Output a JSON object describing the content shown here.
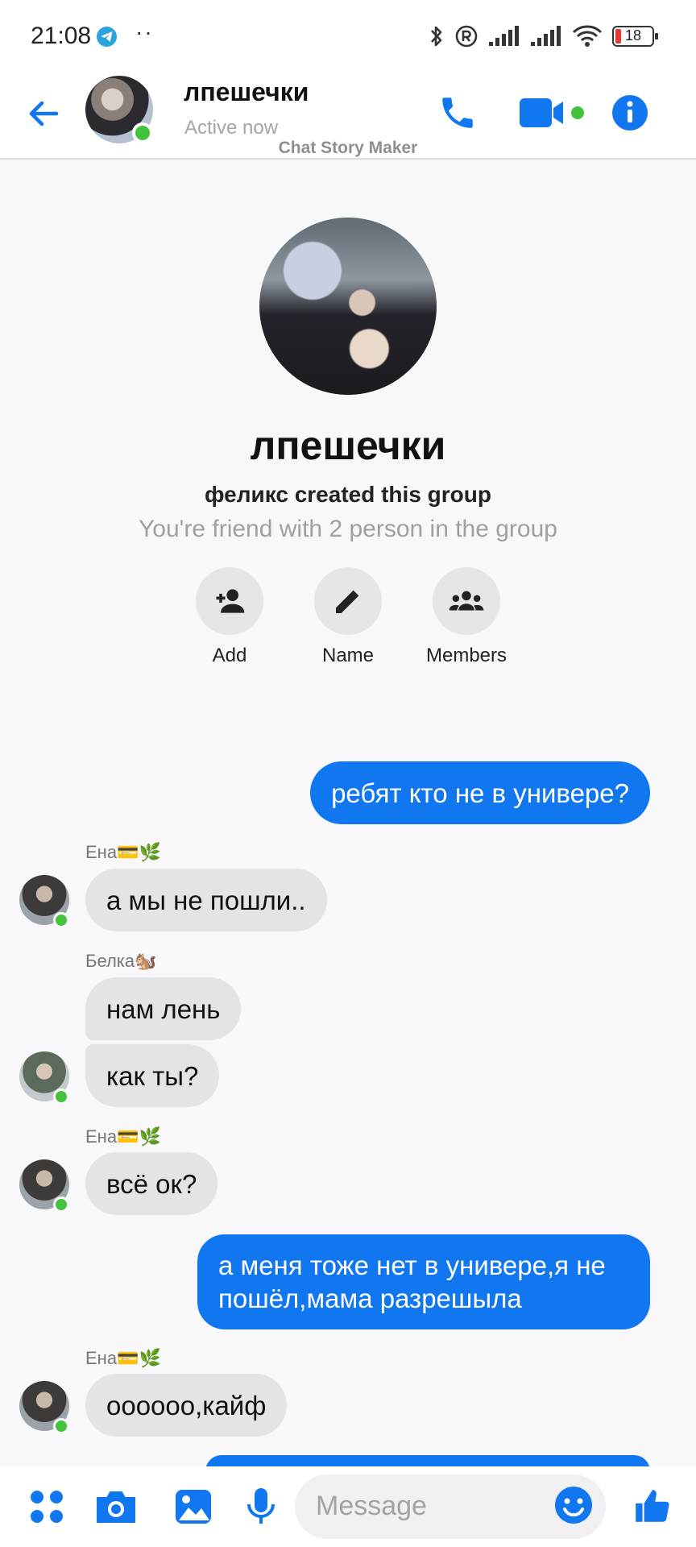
{
  "status_bar": {
    "time": "21:08",
    "dots": "··",
    "battery": "18",
    "icons": [
      "telegram-icon",
      "bluetooth-icon",
      "registered-icon",
      "signal-icon",
      "signal-icon",
      "wifi-icon",
      "battery-icon"
    ]
  },
  "header": {
    "title": "лпешечки",
    "subtitle": "Active now",
    "watermark": "Chat Story Maker",
    "accent": "#1177f0",
    "online_color": "#43c23c"
  },
  "intro": {
    "title": "лпешечки",
    "created": "феликс created this group",
    "friends": "You're friend with 2 person in the group",
    "actions": [
      {
        "label": "Add",
        "icon": "add-person-icon"
      },
      {
        "label": "Name",
        "icon": "pencil-icon"
      },
      {
        "label": "Members",
        "icon": "group-icon"
      }
    ]
  },
  "messages": [
    {
      "side": "out",
      "text": "ребят кто не в универе?"
    },
    {
      "side": "in",
      "sender": "Ена💳🌿",
      "text": "а мы не пошли.."
    },
    {
      "side": "in",
      "sender": "Белка🐿️",
      "text": "нам лень"
    },
    {
      "side": "in",
      "text": "как ты?"
    },
    {
      "side": "in",
      "sender": "Ена💳🌿",
      "text": "всё ок?"
    },
    {
      "side": "out",
      "text": "а меня тоже нет в  универе,я не пошёл,мама разрешыла"
    },
    {
      "side": "in",
      "sender": "Ена💳🌿",
      "text": "оооооо,кайф"
    }
  ],
  "composer": {
    "placeholder": "Message",
    "icons": [
      "apps-icon",
      "camera-icon",
      "image-icon",
      "mic-icon",
      "emoji-icon",
      "thumbs-up-icon"
    ]
  }
}
